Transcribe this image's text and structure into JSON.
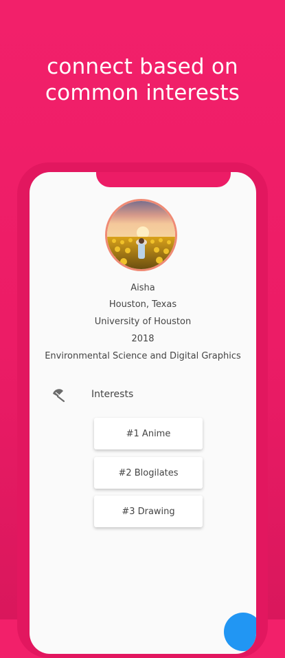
{
  "headline": {
    "line1": "connect based on",
    "line2": "common interests"
  },
  "profile": {
    "name": "Aisha",
    "location": "Houston, Texas",
    "school": "University of Houston",
    "year": "2018",
    "major": "Environmental Science and Digital Graphics"
  },
  "interests": {
    "label": "Interests",
    "icon": "beach-umbrella-icon",
    "items": [
      {
        "label": "#1  Anime"
      },
      {
        "label": "#2  Blogilates"
      },
      {
        "label": "#3  Drawing"
      }
    ]
  },
  "colors": {
    "background": "#ec1c66",
    "avatar_border": "#ef8a74",
    "fab": "#2196f3"
  }
}
